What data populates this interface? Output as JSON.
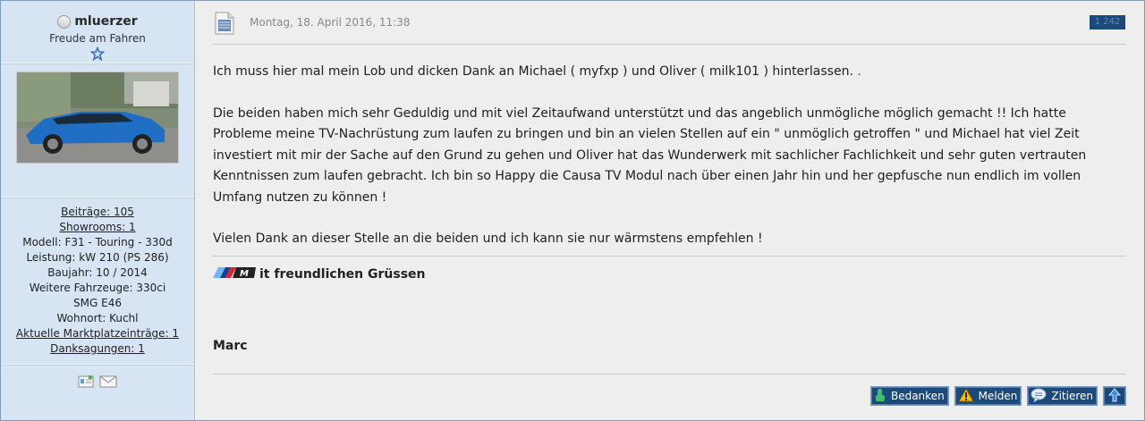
{
  "user": {
    "name": "mluerzer",
    "title": "Freude am Fahren",
    "stats": {
      "beitraege": "Beiträge: 105",
      "showrooms": "Showrooms: 1",
      "modell": "Modell: F31 - Touring - 330d",
      "leistung": "Leistung: kW 210 (PS 286)",
      "baujahr": "Baujahr: 10 / 2014",
      "weitere": "Weitere Fahrzeuge: 330ci",
      "weitere2": "SMG E46",
      "wohnort": "Wohnort: Kuchl",
      "markt": "Aktuelle Marktplatzeinträge: 1",
      "dank": "Danksagungen: 1"
    }
  },
  "post": {
    "date": "Montag, 18. April 2016, 11:38",
    "number": "1 242",
    "paragraphs": [
      "Ich muss hier mal mein Lob und dicken Dank an Michael ( myfxp ) und Oliver ( milk101 ) hinterlassen.",
      "Die beiden haben mich sehr Geduldig und mit viel Zeitaufwand unterstützt und das angeblich unmögliche möglich gemacht !! Ich hatte Probleme meine TV-Nachrüstung zum laufen zu bringen und bin an vielen Stellen auf ein \" unmöglich getroffen \" und Michael hat viel Zeit investiert mit mir der Sache auf den Grund zu gehen und Oliver hat das Wunderwerk mit sachlicher Fachlichkeit und sehr guten vertrauten Kenntnissen zum laufen gebracht. Ich bin so Happy die Causa TV Modul nach über einen Jahr hin und her gepfusche nun endlich im vollen Umfang nutzen zu können !",
      "Vielen Dank an dieser Stelle an die beiden und ich kann sie nur wärmstens empfehlen !"
    ],
    "trailing_dot": ".",
    "signature_line": "it freundlichen Grüssen",
    "signature_name": "Marc"
  },
  "actions": {
    "bedanken": "Bedanken",
    "melden": "Melden",
    "zitieren": "Zitieren"
  },
  "icons": {
    "status": "offline-status-icon",
    "rank": "star-icon",
    "contact_profile": "profile-card-icon",
    "contact_mail": "mail-icon",
    "post_type": "document-icon",
    "thanks": "thumbs-up-icon",
    "report": "warning-icon",
    "quote": "speech-bubble-icon",
    "top": "arrow-up-icon"
  },
  "colors": {
    "sidebar_bg": "#d6e4f3",
    "content_bg": "#eeeeee",
    "button_bg": "#1b4a7a",
    "link_blue": "#1a5aa6"
  }
}
